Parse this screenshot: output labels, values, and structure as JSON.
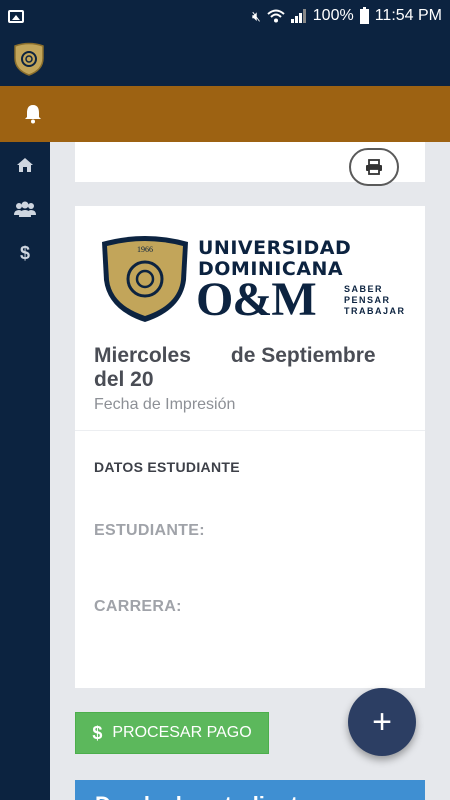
{
  "status_bar": {
    "battery": "100%",
    "time": "11:54 PM"
  },
  "colors": {
    "navy": "#0c2340",
    "gold": "#9d6212",
    "green": "#5cb85c",
    "blue": "#3f8fd2",
    "fab": "#2c3e63"
  },
  "sidebar": {
    "items": [
      {
        "icon": "home-icon"
      },
      {
        "icon": "users-icon"
      },
      {
        "icon": "dollar-icon",
        "glyph": "$"
      }
    ]
  },
  "logo": {
    "line1": "UNIVERSIDAD",
    "line2": "DOMINICANA",
    "brand": "O&M",
    "motto1": "SABER",
    "motto2": "PENSAR",
    "motto3": "TRABAJAR",
    "year": "1966"
  },
  "document": {
    "date_part1": "Miercoles",
    "date_part2": "de Septiembre",
    "date_part3": "del 20",
    "date_caption": "Fecha de Impresión",
    "section_title": "DATOS ESTUDIANTE",
    "student_label": "ESTUDIANTE:",
    "career_label": "CARRERA:"
  },
  "actions": {
    "pay_label": "PROCESAR PAGO",
    "pay_icon": "$",
    "fab_label": "+"
  },
  "blue_card": {
    "title": "Deuda de estudiante"
  }
}
